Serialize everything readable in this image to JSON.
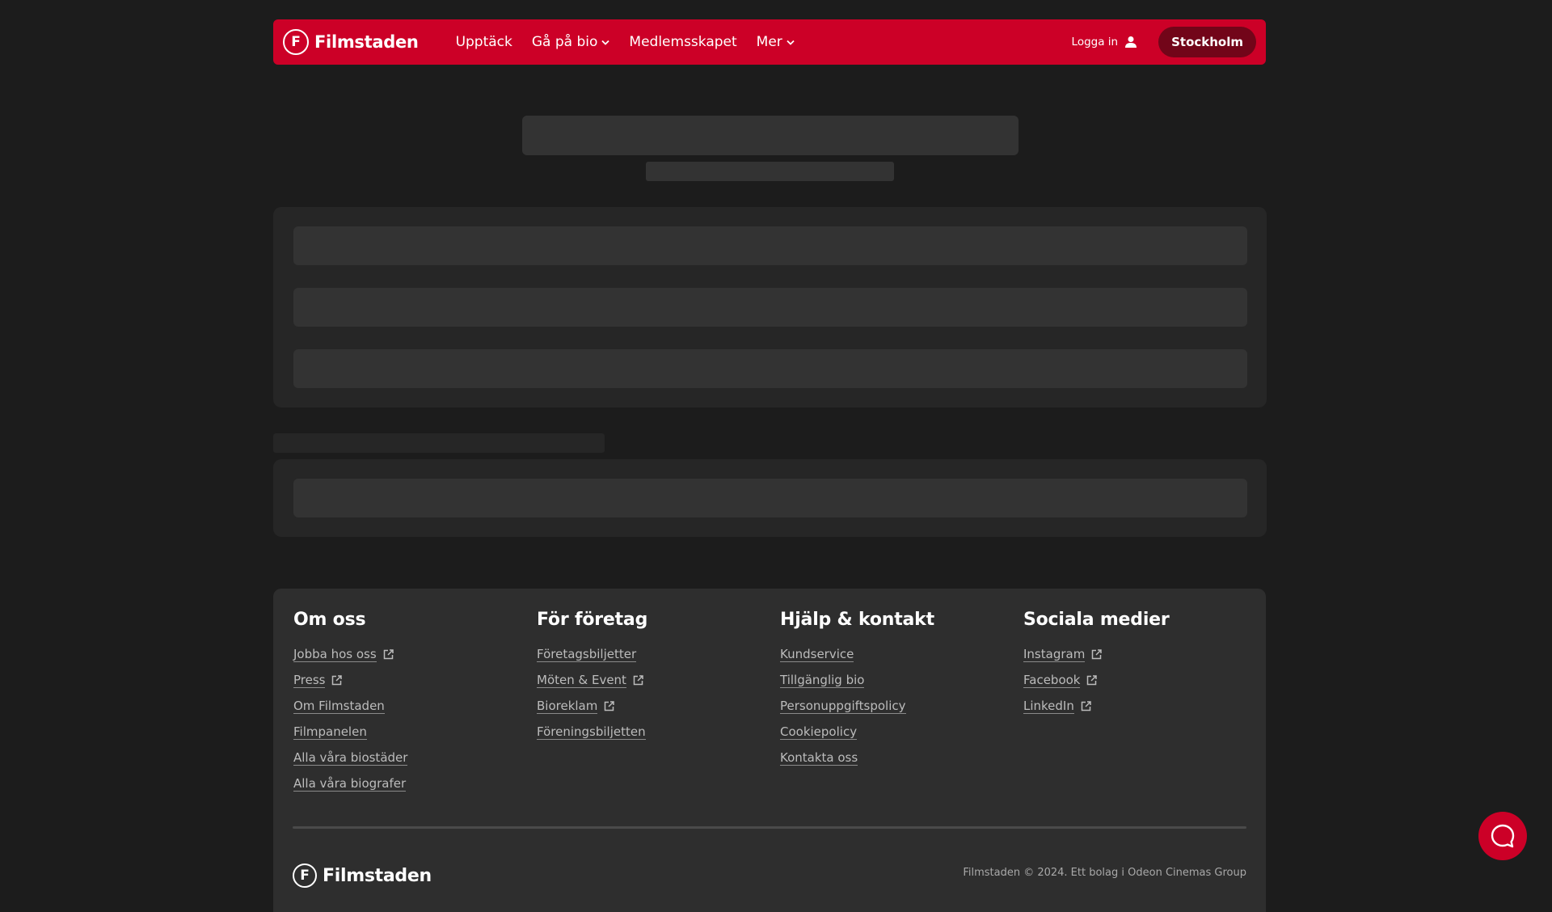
{
  "header": {
    "logo_mark": "F",
    "logo_text": "Filmstaden",
    "nav": [
      {
        "label": "Upptäck"
      },
      {
        "label": "Gå på bio"
      },
      {
        "label": "Medlemsskapet"
      },
      {
        "label": "Mer"
      }
    ],
    "login_label": "Logga in",
    "city_label": "Stockholm"
  },
  "footer": {
    "columns": [
      {
        "title": "Om oss",
        "links": [
          "Jobba hos oss",
          "Press",
          "Om Filmstaden",
          "Filmpanelen",
          "Alla våra biostäder",
          "Alla våra biografer"
        ]
      },
      {
        "title": "För företag",
        "links": [
          "Företagsbiljetter",
          "Möten & Event",
          "Bioreklam",
          "Föreningsbiljetten"
        ]
      },
      {
        "title": "Hjälp & kontakt",
        "links": [
          "Kundservice",
          "Tillgänglig bio",
          "Personuppgiftspolicy",
          "Cookiepolicy",
          "Kontakta oss"
        ]
      },
      {
        "title": "Sociala medier",
        "links": [
          "Instagram",
          "Facebook",
          "LinkedIn"
        ]
      }
    ],
    "bottom_logo_text": "Filmstaden",
    "bottom_right": "Filmstaden © 2024. Ett bolag i Odeon Cinemas Group"
  },
  "colors": {
    "brand": "#cc0027",
    "background": "#1c1c1c",
    "panel": "#262626",
    "skeleton": "#333333"
  },
  "icons": [
    "user-icon",
    "chevron-down-icon",
    "external-link-icon",
    "chat-icon"
  ]
}
